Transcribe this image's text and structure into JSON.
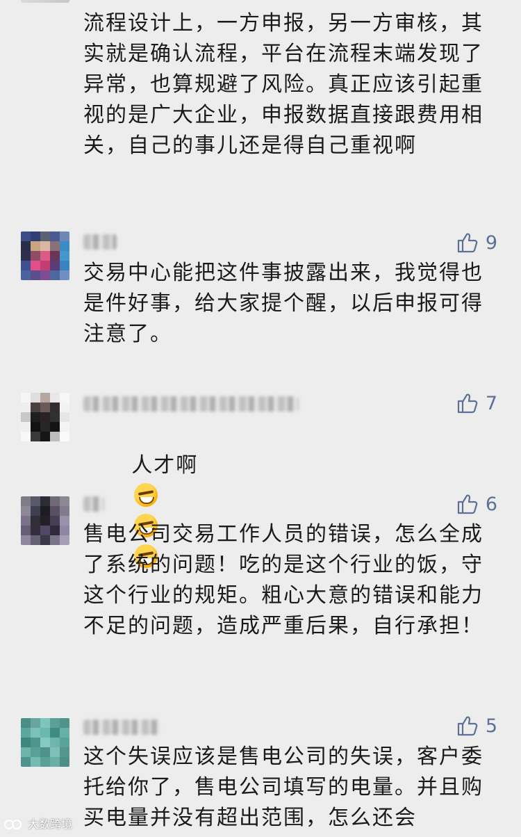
{
  "comments": {
    "first": {
      "text": "流程设计上，一方申报，另一方审核，其实就是确认流程，平台在流程末端发现了异常，也算规避了风险。真正应该引起重视的是广大企业，申报数据直接跟费用相关，自己的事儿还是得自己重视啊"
    },
    "second": {
      "likes": "9",
      "text": "交易中心能把这件事披露出来，我觉得也是件好事，给大家提个醒，以后申报可得注意了。"
    },
    "third": {
      "likes": "7",
      "text": "人才啊"
    },
    "fourth": {
      "likes": "6",
      "text": "售电公司交易工作人员的错误，怎么全成了系统的问题！吃的是这个行业的饭，守这个行业的规矩。粗心大意的错误和能力不足的问题，造成严重后果，自行承担！"
    },
    "fifth": {
      "likes": "5",
      "text": "这个失误应该是售电公司的失误，客户委托给你了，售电公司填写的电量。并且购买电量并没有超出范围，怎么还会"
    }
  },
  "watermark": {
    "text": "大数跨境"
  },
  "icons": {
    "thumb": "thumbs-up-icon",
    "emoji": "laughing-crying-emoji-icon"
  }
}
